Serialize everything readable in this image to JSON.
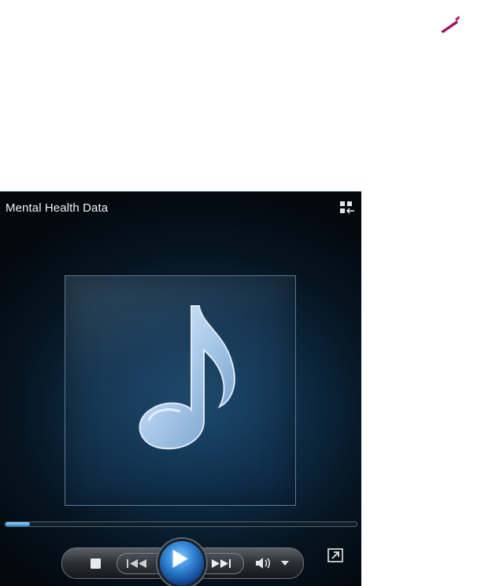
{
  "window": {
    "title": "Mental Health Data"
  },
  "playback": {
    "progress_fraction": 0.07
  },
  "icons": {
    "corner": "pen-stroke-icon",
    "switch": "switch-to-library-icon",
    "art": "music-note-icon",
    "stop": "stop-icon",
    "previous": "previous-track-icon",
    "play": "play-icon",
    "next": "next-track-icon",
    "volume": "speaker-icon",
    "volume_menu": "chevron-down-icon",
    "now_playing": "switch-to-now-playing-icon"
  },
  "colors": {
    "accent": "#2f7fd1",
    "corner_mark": "#a0155a"
  }
}
